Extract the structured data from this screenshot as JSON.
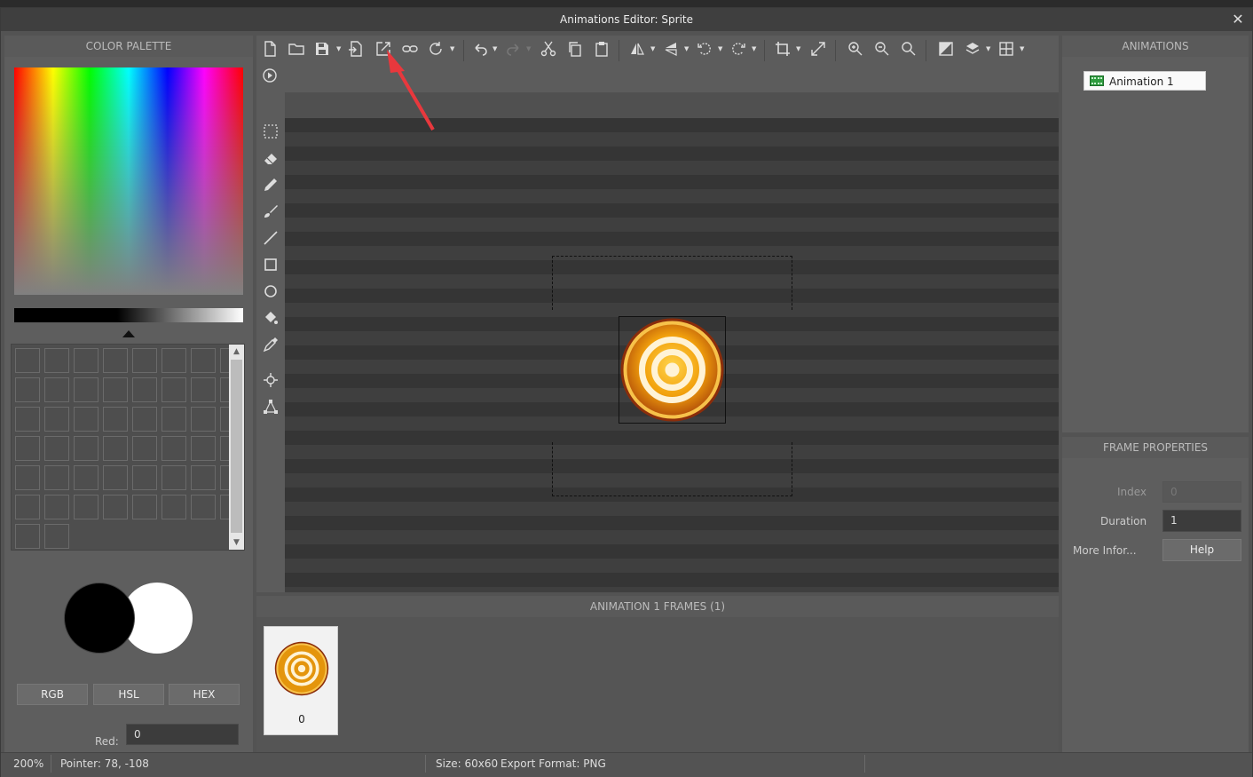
{
  "window": {
    "title": "Animations Editor: Sprite",
    "close_glyph": "✕"
  },
  "color_palette": {
    "header": "COLOR PALETTE",
    "modes": [
      "RGB",
      "HSL",
      "HEX"
    ],
    "red_label": "Red:",
    "red_value": "0",
    "foreground": "#000000",
    "background": "#ffffff"
  },
  "toolbar": {
    "icons": [
      "new-file-icon",
      "open-folder-icon",
      "save-icon",
      "import-icon",
      "export-icon",
      "link-icon",
      "refresh-icon",
      "undo-icon",
      "redo-icon",
      "cut-icon",
      "copy-icon",
      "paste-icon",
      "flip-horizontal-icon",
      "flip-vertical-icon",
      "rotate-left-icon",
      "rotate-right-icon",
      "crop-icon",
      "resize-icon",
      "zoom-in-icon",
      "zoom-out-icon",
      "zoom-reset-icon",
      "mask-icon",
      "layers-icon",
      "grid-icon",
      "play-icon"
    ]
  },
  "tools": [
    "select-icon",
    "eraser-icon",
    "pencil-icon",
    "brush-icon",
    "line-icon",
    "rectangle-icon",
    "ellipse-icon",
    "fill-bucket-icon",
    "eyedropper-icon",
    "origin-icon",
    "points-icon"
  ],
  "frames": {
    "header": "ANIMATION 1 FRAMES (1)",
    "items": [
      {
        "index": "0"
      }
    ]
  },
  "animations": {
    "header": "ANIMATIONS",
    "items": [
      {
        "label": "Animation 1"
      }
    ]
  },
  "frame_properties": {
    "header": "FRAME PROPERTIES",
    "index_label": "Index",
    "index_value": "0",
    "duration_label": "Duration",
    "duration_value": "1",
    "more_label": "More Infor...",
    "help_label": "Help"
  },
  "status": {
    "zoom": "200%",
    "pointer": "Pointer: 78, -108",
    "size": "Size: 60x60",
    "export": "Export Format: PNG"
  },
  "colors": {
    "accent_arrow": "#e8383d",
    "sprite_gold": "#f2a10c",
    "sprite_rim": "#8b2d0a"
  }
}
